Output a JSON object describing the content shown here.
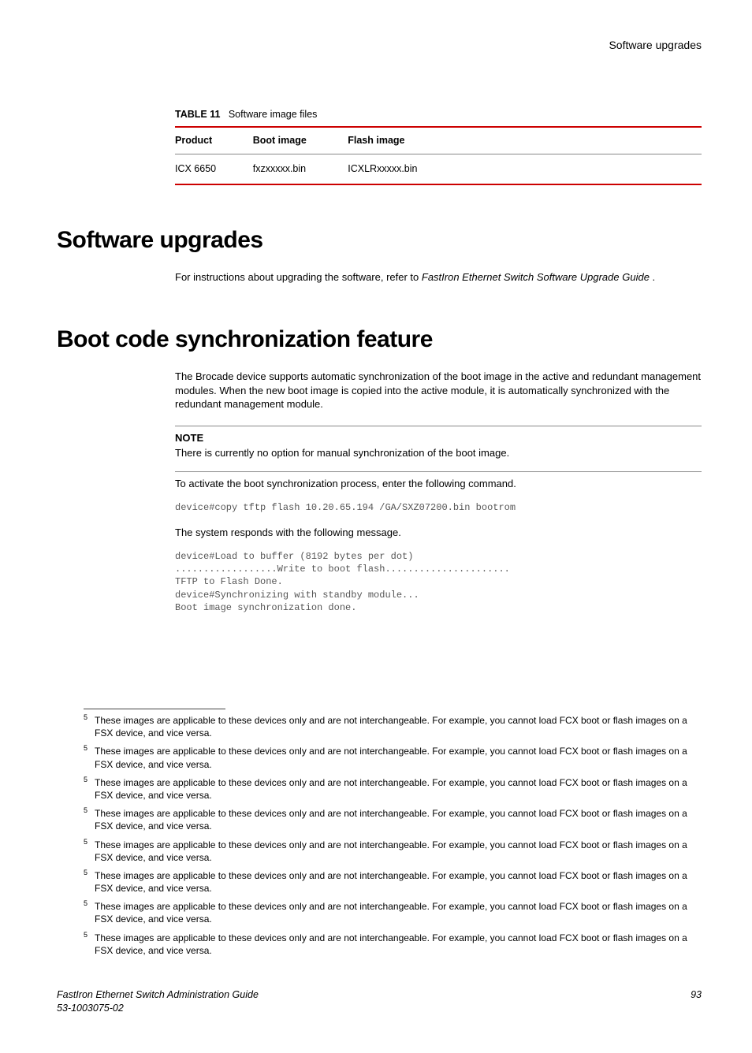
{
  "header": {
    "right": "Software upgrades"
  },
  "table": {
    "caption_label": "TABLE 11",
    "caption_text": "Software image files",
    "headers": {
      "c0": "Product",
      "c1": "Boot image",
      "c2": "Flash image"
    },
    "row": {
      "c0": "ICX 6650",
      "c1": "fxzxxxxx.bin",
      "c2": "ICXLRxxxxx.bin"
    }
  },
  "sec1": {
    "title": "Software upgrades",
    "p1a": "For instructions about upgrading the software, refer to ",
    "p1b": "FastIron Ethernet Switch Software Upgrade Guide",
    "p1c": " ."
  },
  "sec2": {
    "title": "Boot code synchronization feature",
    "p1": "The Brocade device supports automatic synchronization of the boot image in the active and redundant management modules. When the new boot image is copied into the active module, it is automatically synchronized with the redundant management module.",
    "note_label": "NOTE",
    "note_text": "There is currently no option for manual synchronization of the boot image.",
    "p2": "To activate the boot synchronization process, enter the following command.",
    "code1": "device#copy tftp flash 10.20.65.194 /GA/SXZ07200.bin bootrom",
    "p3": "The system responds with the following message.",
    "code2": "device#Load to buffer (8192 bytes per dot)\n..................Write to boot flash......................\nTFTP to Flash Done.\ndevice#Synchronizing with standby module...\nBoot image synchronization done."
  },
  "footnotes": {
    "num": "5",
    "text": "These images are applicable to these devices only and are not interchangeable. For example, you cannot load FCX boot or flash images on a FSX device, and vice versa."
  },
  "footer": {
    "title": "FastIron Ethernet Switch Administration Guide",
    "doc": "53-1003075-02",
    "page": "93"
  }
}
